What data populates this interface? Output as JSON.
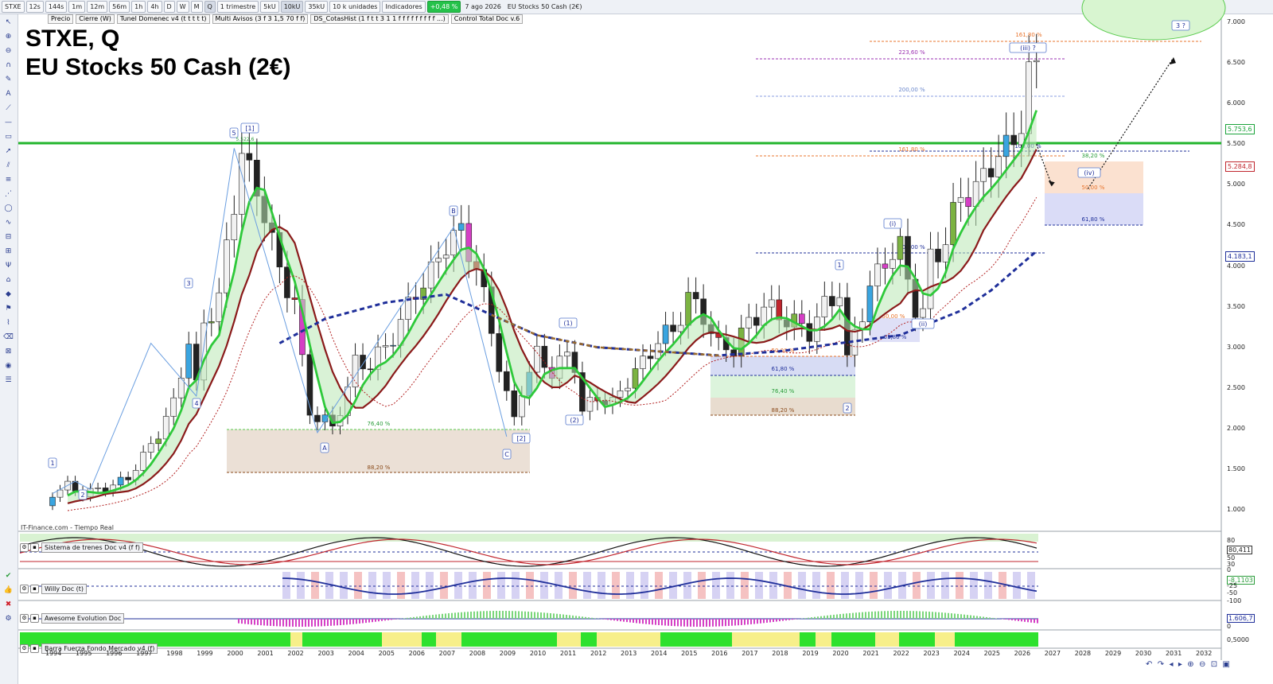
{
  "toolbar": {
    "symbol": "STXE",
    "timeframes": [
      "12s",
      "144s",
      "1m",
      "12m",
      "56m",
      "1h",
      "4h",
      "D",
      "W",
      "M",
      "Q"
    ],
    "period_select": "1 trimestre",
    "bar_options": [
      "5kU",
      "10kU",
      "35kU"
    ],
    "units_select": "10 k unidades",
    "indicators_label": "Indicadores",
    "change_badge": "+0,48 %",
    "date": "7 ago 2026",
    "instrument": "EU Stocks 50 Cash (2€)"
  },
  "legend_tabs": [
    "Precio",
    "Cierre (W)",
    "Tunel Domenec v4 (t t t t t)",
    "Multi Avisos (3 f 3 1,5 70 f f)",
    "DS_CotasHist (1 f t t 3 1 1 f f f f f f f f f ...)",
    "Control Total Doc v.6"
  ],
  "chart_title": {
    "line1": "STXE, Q",
    "line2": "EU Stocks 50 Cash (2€)"
  },
  "source": "IT-Finance.com - Tiempo Real",
  "price_axis": [
    "7.000",
    "6.500",
    "6.000",
    "5.500",
    "5.000",
    "4.500",
    "4.000",
    "3.500",
    "3.000",
    "2.500",
    "2.000",
    "1.500",
    "1.000"
  ],
  "price_tags": [
    {
      "text": "5.753,6",
      "color": "#1aa33a"
    },
    {
      "text": "5.284,8",
      "color": "#c0262e"
    },
    {
      "text": "4.183,1",
      "color": "#1f2f9a"
    }
  ],
  "year_axis": [
    "1994",
    "1995",
    "1996",
    "1997",
    "1998",
    "1999",
    "2000",
    "2001",
    "2002",
    "2003",
    "2004",
    "2005",
    "2006",
    "2007",
    "2008",
    "2009",
    "2010",
    "2011",
    "2012",
    "2013",
    "2014",
    "2015",
    "2016",
    "2017",
    "2018",
    "2019",
    "2020",
    "2021",
    "2022",
    "2023",
    "2024",
    "2025",
    "2026",
    "2027",
    "2028",
    "2029",
    "2030",
    "2031",
    "2032"
  ],
  "fib_labels": [
    {
      "text": "161,80 %",
      "color": "#e8742c"
    },
    {
      "text": "223,60 %",
      "color": "#9a2fb0"
    },
    {
      "text": "200,00 %",
      "color": "#6a87cc"
    },
    {
      "text": "161,80 %",
      "color": "#e8742c"
    },
    {
      "text": "100,00 %",
      "color": "#1f2f9a"
    },
    {
      "text": "38,20 %",
      "color": "#2a9c3a"
    },
    {
      "text": "50,00 %",
      "color": "#e8742c"
    },
    {
      "text": "61,80 %",
      "color": "#1f2f9a"
    },
    {
      "text": "100,00 %",
      "color": "#1f2f9a"
    },
    {
      "text": "50,00 %",
      "color": "#e8742c"
    },
    {
      "text": "61,80 %",
      "color": "#1f2f9a"
    },
    {
      "text": "50,00 %",
      "color": "#e8742c"
    },
    {
      "text": "61,80 %",
      "color": "#1f2f9a"
    },
    {
      "text": "76,40 %",
      "color": "#2a9c3a"
    },
    {
      "text": "88,20 %",
      "color": "#8a4a1a"
    },
    {
      "text": "76,40 %",
      "color": "#2a9c3a"
    },
    {
      "text": "88,20 %",
      "color": "#8a4a1a"
    }
  ],
  "wave_labels": [
    "1",
    "2",
    "3",
    "4",
    "5",
    "[1]",
    "A",
    "B",
    "C",
    "[2]",
    "(1)",
    "(2)",
    "1",
    "2",
    "(i)",
    "(ii)",
    "(iii) ?",
    "(iv)",
    "3 ?"
  ],
  "point_label": "5.522,6",
  "indicators": [
    {
      "name": "Sistema de trenes Doc v4 (f f)",
      "axis": [
        "80",
        "50",
        "30",
        "0"
      ],
      "value": "80,411"
    },
    {
      "name": "Willy Doc (t)",
      "axis": [
        "-25",
        "-50",
        "-100"
      ],
      "value": "-8,1103"
    },
    {
      "name": "Awesome Evolution Doc",
      "axis": [
        "1.606,7",
        "0"
      ],
      "value": ""
    },
    {
      "name": "Barra Fuerza Fondo Mercado v4 (f)",
      "axis": [
        "0,5000"
      ],
      "value": ""
    }
  ],
  "colors": {
    "bull": "#2b8a35",
    "bear": "#c0262e",
    "ema_fast": "#2ec93a",
    "ema_slow": "#8a1a1a",
    "dashed_blue": "#1f2f9a",
    "resistance": "#22b52c"
  }
}
